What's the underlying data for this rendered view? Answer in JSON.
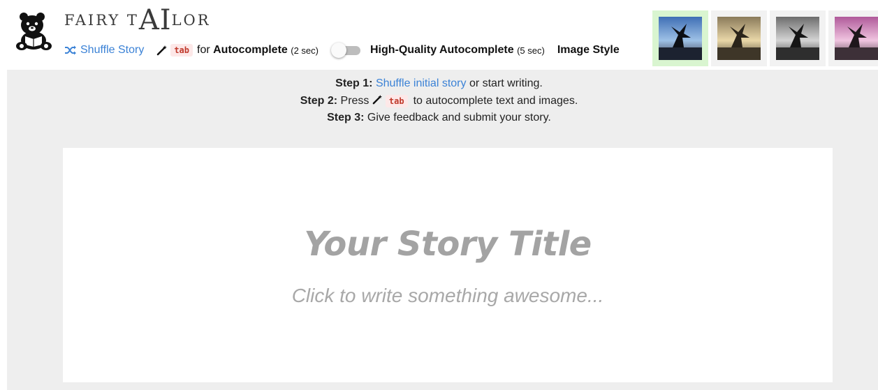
{
  "brand": {
    "prefix": "FAIRY T",
    "highlight": "AI",
    "suffix": "LOR"
  },
  "toolbar": {
    "shuffle_label": "Shuffle Story",
    "tab_key": "tab",
    "autocomplete_prefix": "for",
    "autocomplete_label": "Autocomplete",
    "autocomplete_time": "(2 sec)",
    "hq_label": "High-Quality Autocomplete",
    "hq_time": "(5 sec)",
    "image_style_label": "Image Style"
  },
  "image_styles": [
    {
      "id": "original",
      "selected": true
    },
    {
      "id": "sepia",
      "selected": false
    },
    {
      "id": "grayscale",
      "selected": false
    },
    {
      "id": "pink",
      "selected": false
    }
  ],
  "steps": {
    "step1_label": "Step 1:",
    "step1_link": "Shuffle initial story",
    "step1_rest": "or start writing.",
    "step2_label": "Step 2:",
    "step2_press": "Press",
    "step2_key": "tab",
    "step2_rest": "to autocomplete text and images.",
    "step3_label": "Step 3:",
    "step3_rest": "Give feedback and submit your story."
  },
  "editor": {
    "title_placeholder": "Your Story Title",
    "body_placeholder": "Click to write something awesome..."
  },
  "colors": {
    "link": "#3b82d6",
    "kbd_bg": "#fde8e8",
    "kbd_fg": "#c0392b",
    "selected_style_bg": "#d9f5d0",
    "workspace_bg": "#eeeeee",
    "placeholder": "#a3a3a3"
  }
}
